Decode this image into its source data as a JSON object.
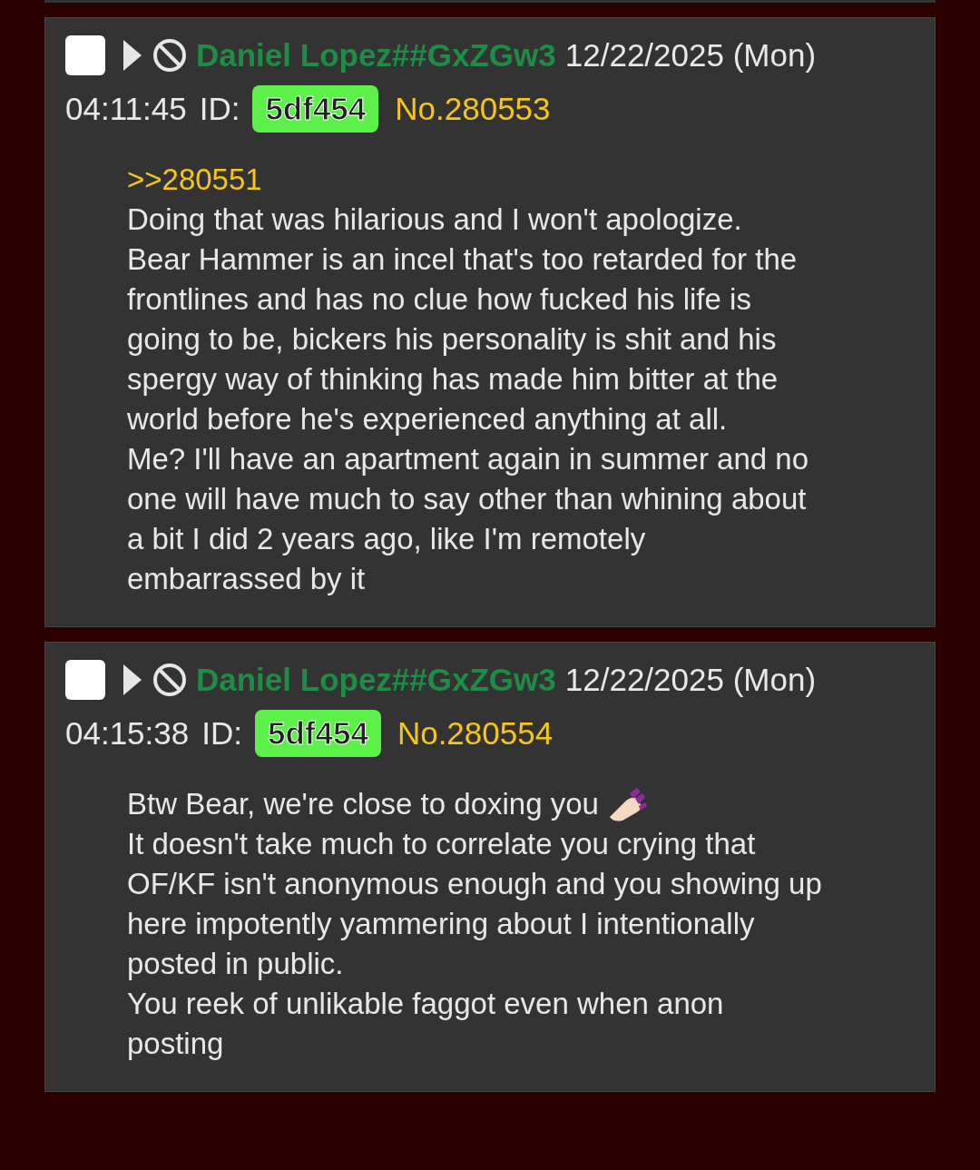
{
  "posts": [
    {
      "checked": false,
      "name": "Daniel Lopez##GxZGw3",
      "date": "12/22/2025 (Mon)",
      "time": "04:11:45",
      "id_label": "ID:",
      "id": "5df454",
      "number": "No.280553",
      "lines": [
        {
          "kind": "quote",
          "text": ">>280551"
        },
        {
          "kind": "text",
          "text": "Doing that was hilarious and I won't apologize."
        },
        {
          "kind": "text",
          "text": "Bear Hammer is an incel that's too retarded for the frontlines and has no clue how fucked his life is going to be, bickers his personality is shit and his spergy way of thinking has made him bitter at the world before he's experienced anything at all."
        },
        {
          "kind": "text",
          "text": "Me? I'll have an apartment again in summer and no one will have much to say other than whining about a bit I did 2 years ago, like I'm remotely embarrassed by it"
        }
      ]
    },
    {
      "checked": false,
      "name": "Daniel Lopez##GxZGw3",
      "date": "12/22/2025 (Mon)",
      "time": "04:15:38",
      "id_label": "ID:",
      "id": "5df454",
      "number": "No.280554",
      "lines": [
        {
          "kind": "text_icon",
          "text": "Btw Bear, we're close to doxing you"
        },
        {
          "kind": "text",
          "text": "It doesn't take much to correlate you crying that OF/KF isn't anonymous enough and you showing up here impotently yammering about I intentionally posted in public."
        },
        {
          "kind": "text",
          "text": "You reek of unlikable faggot even when anon posting"
        }
      ]
    }
  ]
}
